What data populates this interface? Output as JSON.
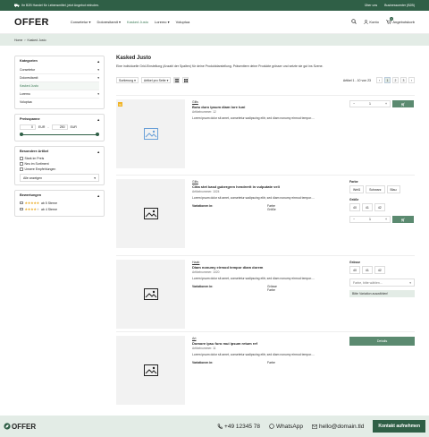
{
  "topbar": {
    "message": "Ihr B2B Handel für Lebensmittel, jetzt Angebot einholen.",
    "lang": "Über uns",
    "portal": "Businesscenter (B2B)"
  },
  "header": {
    "logo": "OFFER",
    "nav": [
      "Consetetur",
      "Doloresitamit",
      "Kasked Justo",
      "Loremo",
      "Voluptua"
    ],
    "nav_active": "Kasked Justo",
    "account": "Konto",
    "cart": "Angebotskorb",
    "cart_count": "0"
  },
  "breadcrumb": {
    "home": "Home",
    "current": "Kasked Justo"
  },
  "sidebar": {
    "categories_title": "Kategorien",
    "categories": [
      "Consetetur",
      "Doloresitamit",
      "Kasked Justo",
      "Loremo",
      "Voluptua"
    ],
    "price_title": "Preisspanne",
    "price_min": "0",
    "price_max": "250",
    "currency": "EUR",
    "special_title": "Besondere Artikel",
    "special": [
      "Stark im Preis",
      "Neu im Sortiment",
      "Unsere Empfehlungen"
    ],
    "show_all": "Alle anzeigen",
    "ratings_title": "Bewertungen",
    "ratings": [
      "ab 5 Sterne",
      "ab 4 Sterne"
    ]
  },
  "main": {
    "title": "Kasked Justo",
    "intro": "Eine individuelle Grid-Einstellung (Anzahl der Spalten) für deine Produktdarstellung. Präsentiere deine Produkte grösser und setzte sie gut ins Szene.",
    "sort_label": "Sortierung",
    "per_page_label": "Artikel pro Seite",
    "pager_info": "Artikel 1 - 10 von 23",
    "pages": [
      "1",
      "2",
      "3"
    ],
    "products": [
      {
        "brand": "Gills",
        "title": "Botu duro ipsum diam lore tuni",
        "artnr": "Artikelnummer: 12",
        "desc": "Lorem ipsum dolor sit amet, consetetur sadipscing elitr, sed diam nonumy eirmod tempor....",
        "badge": "%",
        "qty": "1"
      },
      {
        "brand": "Gills",
        "title": "Clita stet kasd gubergren hendrerit in vulputate veli",
        "artnr": "Artikelnummer: 1024",
        "desc": "Lorem ipsum dolor sit amet, consetetur sadipscing elitr, sed diam nonumy eirmod tempor....",
        "variants_label": "Variationen in:",
        "variants": [
          "Farbe",
          "Größe"
        ],
        "color_label": "Farbe",
        "colors": [
          "Weiß",
          "Schwarz",
          "Blau"
        ],
        "size_label": "Größe",
        "sizes": [
          "40",
          "41",
          "42"
        ],
        "qty": "1"
      },
      {
        "brand": "Haab",
        "title": "Diam nonumy eirmod tempor diam dorem",
        "artnr": "Artikelnummer: 1020",
        "desc": "Lorem ipsum dolor sit amet, consetetur sadipscing elitr, sed diam nonumy eirmod tempor....",
        "variants_label": "Variationen in:",
        "variants": [
          "Grösse",
          "Farbe"
        ],
        "size_label": "Grösse",
        "sizes": [
          "40",
          "41",
          "42"
        ],
        "select_placeholder": "Farbe, bitte wählen...",
        "alert": "Bitte Variation auswählen!"
      },
      {
        "brand": "Art",
        "title": "Domore ipsu furo mui ipsum retum ref",
        "artnr": "Artikelnummer: 11",
        "desc": "Lorem ipsum dolor sit amet, consetetur sadipscing elitr, sed diam nonumy eirmod tempor....",
        "variants_label": "Variationen in:",
        "variants": [
          "Farbe"
        ],
        "details": "Details"
      }
    ]
  },
  "footer": {
    "logo": "OFFER",
    "phone": "+49 12345 78",
    "whatsapp": "WhatsApp",
    "email": "hello@domain.tld",
    "contact_button": "Kontakt aufnehmen"
  },
  "colors": {
    "brand": "#2f5f46",
    "accent": "#5b8a70",
    "light": "#e3ece6",
    "star": "#e9a920"
  }
}
